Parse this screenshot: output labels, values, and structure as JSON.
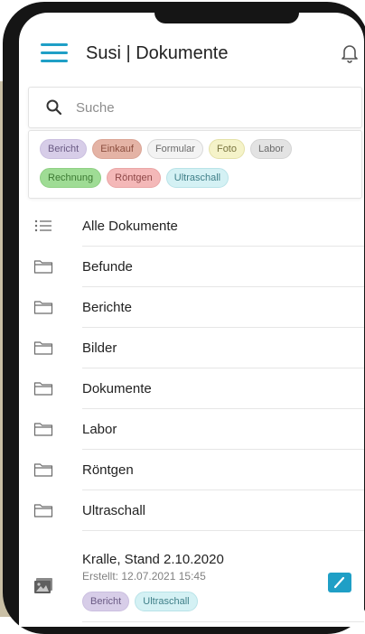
{
  "app": {
    "title": "Susi | Dokumente"
  },
  "search": {
    "placeholder": "Suche"
  },
  "filter_tags": [
    [
      {
        "label": "Bericht",
        "bg": "#d7cde8",
        "fg": "#6a5a84",
        "border": "#cbbfe0"
      },
      {
        "label": "Einkauf",
        "bg": "#e4b3a5",
        "fg": "#8b4e3e",
        "border": "#dba596"
      },
      {
        "label": "Formular",
        "bg": "#f3f3f3",
        "fg": "#6b6b6b",
        "border": "#d9d9d9"
      },
      {
        "label": "Foto",
        "bg": "#f5f3c9",
        "fg": "#7a7640",
        "border": "#e4e1a8"
      },
      {
        "label": "Labor",
        "bg": "#e3e3e3",
        "fg": "#6b6b6b",
        "border": "#d4d4d4"
      }
    ],
    [
      {
        "label": "Rechnung",
        "bg": "#9fdc95",
        "fg": "#3d7a33",
        "border": "#8fd084"
      },
      {
        "label": "Röntgen",
        "bg": "#f4b8b8",
        "fg": "#8e4747",
        "border": "#eaa6a6"
      },
      {
        "label": "Ultraschall",
        "bg": "#d4f1f4",
        "fg": "#3f7f88",
        "border": "#b9e3e8"
      }
    ]
  ],
  "list": [
    {
      "icon": "list-icon",
      "label": "Alle Dokumente"
    },
    {
      "icon": "folder-icon",
      "label": "Befunde"
    },
    {
      "icon": "folder-icon",
      "label": "Berichte"
    },
    {
      "icon": "folder-icon",
      "label": "Bilder"
    },
    {
      "icon": "folder-icon",
      "label": "Dokumente"
    },
    {
      "icon": "folder-icon",
      "label": "Labor"
    },
    {
      "icon": "folder-icon",
      "label": "Röntgen"
    },
    {
      "icon": "folder-icon",
      "label": "Ultraschall"
    }
  ],
  "document": {
    "icon": "image-icon",
    "title": "Kralle, Stand 2.10.2020",
    "created": "Erstellt: 12.07.2021 15:45",
    "tags": [
      {
        "label": "Bericht",
        "bg": "#d7cde8",
        "fg": "#6a5a84",
        "border": "#cbbfe0"
      },
      {
        "label": "Ultraschall",
        "bg": "#d4f1f4",
        "fg": "#3f7f88",
        "border": "#b9e3e8"
      }
    ]
  },
  "colors": {
    "accent": "#1f9fc6",
    "icon": "#6b6b6b"
  }
}
